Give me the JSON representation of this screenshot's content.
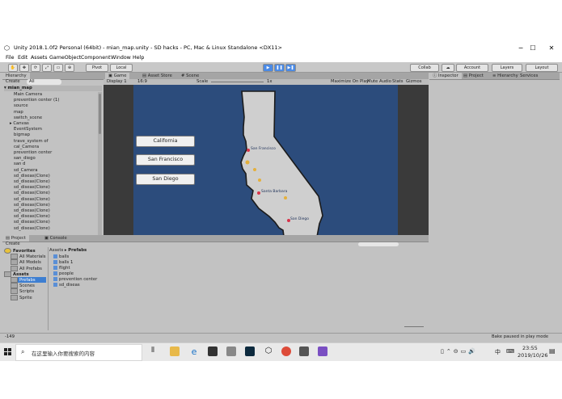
{
  "titlebar": {
    "title": "Unity 2018.1.0f2 Personal (64bit) - mian_map.unity - SD hacks - PC, Mac & Linux Standalone <DX11>"
  },
  "menu": [
    "File",
    "Edit",
    "Assets",
    "GameObject",
    "Component",
    "Window",
    "Help"
  ],
  "toolbar": {
    "pivot": "Pivot",
    "local": "Local",
    "collab": "Collab",
    "account": "Account",
    "layers": "Layers",
    "layout": "Layout"
  },
  "hierarchy": {
    "tab": "Hierarchy",
    "create": "Create",
    "search": "All",
    "scene": "mian_map",
    "items": [
      "Main Camera",
      "prevention center (1)",
      "source",
      "map",
      "switch_scene",
      "Canvas",
      "EventSystem",
      "bigmap",
      "trave_system of",
      "cal_Camera",
      "prevention center",
      "san_diego",
      "san d",
      "sd_Camera",
      "sd_diseas(Clone)",
      "sd_diseas(Clone)",
      "sd_diseas(Clone)",
      "sd_diseas(Clone)",
      "sd_diseas(Clone)",
      "sd_diseas(Clone)",
      "sd_diseas(Clone)",
      "sd_diseas(Clone)",
      "sd_diseas(Clone)",
      "sd_diseas(Clone)"
    ]
  },
  "game": {
    "tabs": [
      "Game",
      "Asset Store",
      "Scene"
    ],
    "display": "Display 1",
    "aspect": "16:9",
    "scale_label": "Scale",
    "scale_value": "1x",
    "options": [
      "Maximize On Play",
      "Mute Audio",
      "Stats",
      "Gizmos"
    ],
    "buttons": [
      "California",
      "San Francisco",
      "San Diego"
    ],
    "map_labels": [
      "San Francisco",
      "Santa Barbara",
      "San Diego"
    ]
  },
  "inspector": {
    "tabs": [
      "Inspector",
      "Project",
      "Hierarchy",
      "Services"
    ]
  },
  "project": {
    "tabs": [
      "Project",
      "Console"
    ],
    "create": "Create",
    "tree": [
      {
        "label": "Favorites",
        "bold": true
      },
      {
        "label": "All Materials"
      },
      {
        "label": "All Models"
      },
      {
        "label": "All Prefabs"
      },
      {
        "label": "Assets",
        "bold": true
      },
      {
        "label": "Prefabs",
        "selected": true
      },
      {
        "label": "Scenes"
      },
      {
        "label": "Scripts"
      },
      {
        "label": "Sprite"
      }
    ],
    "breadcrumb": [
      "Assets",
      "Prefabs"
    ],
    "assets": [
      "balls",
      "balls 1",
      "flight",
      "people",
      "prevention center",
      "sd_diseas"
    ]
  },
  "status": {
    "left": "-149",
    "right": "Bake paused in play mode"
  },
  "taskbar": {
    "search": "在这里输入你要搜索的内容",
    "time": "23:55",
    "date": "2019/10/26",
    "ime": "中"
  },
  "colors": {
    "scene_bg": "#2c4c7c",
    "selection": "#3d7ed1",
    "play_active": "#4a8ae6"
  }
}
